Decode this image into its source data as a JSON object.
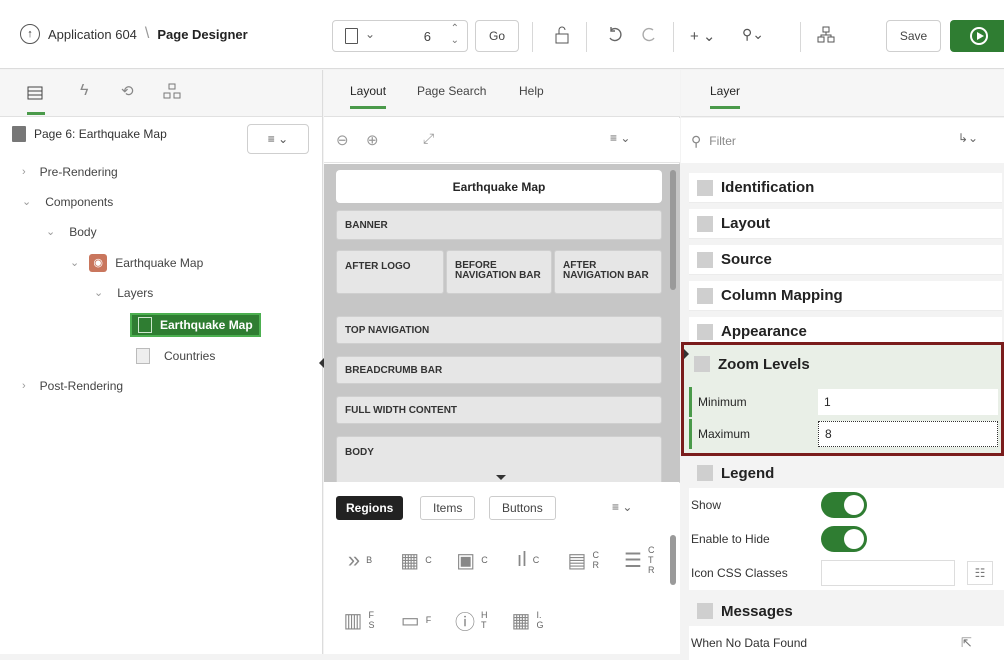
{
  "toolbar": {
    "app_name": "Application 604",
    "page_designer": "Page Designer",
    "page_number": "6",
    "go_label": "Go",
    "save_label": "Save"
  },
  "left": {
    "page_title": "Page 6: Earthquake Map",
    "tree": {
      "pre_rendering": "Pre-Rendering",
      "components": "Components",
      "body": "Body",
      "region": "Earthquake Map",
      "layers": "Layers",
      "layer_selected": "Earthquake Map",
      "layer_other": "Countries",
      "post_rendering": "Post-Rendering"
    }
  },
  "middle": {
    "tabs": [
      "Layout",
      "Page Search",
      "Help"
    ],
    "page_title": "Earthquake Map",
    "slots": {
      "banner": "BANNER",
      "after_logo": "AFTER LOGO",
      "before_nav": "BEFORE NAVIGATION BAR",
      "after_nav": "AFTER NAVIGATION BAR",
      "top_nav": "TOP NAVIGATION",
      "breadcrumb": "BREADCRUMB BAR",
      "full_width": "FULL WIDTH CONTENT",
      "body": "BODY"
    },
    "gallery_tabs": [
      "Regions",
      "Items",
      "Buttons"
    ],
    "gallery_labels": [
      "B",
      "C",
      "C",
      "C",
      "C R",
      "C T R",
      "F S",
      "F",
      "H T",
      "I. G"
    ]
  },
  "right": {
    "tab": "Layer",
    "filter_placeholder": "Filter",
    "groups": {
      "identification": "Identification",
      "layout": "Layout",
      "source": "Source",
      "column_mapping": "Column Mapping",
      "appearance": "Appearance",
      "zoom_levels": "Zoom Levels",
      "legend": "Legend",
      "messages": "Messages"
    },
    "zoom": {
      "min_label": "Minimum",
      "min_value": "1",
      "max_label": "Maximum",
      "max_value": "8"
    },
    "legend_props": {
      "show": "Show",
      "enable_hide": "Enable to Hide",
      "icon_css": "Icon CSS Classes",
      "icon_css_value": ""
    },
    "messages_props": {
      "no_data": "When No Data Found"
    }
  },
  "colors": {
    "accent_green": "#2f7d32",
    "highlight_border": "#7a1c1c"
  }
}
